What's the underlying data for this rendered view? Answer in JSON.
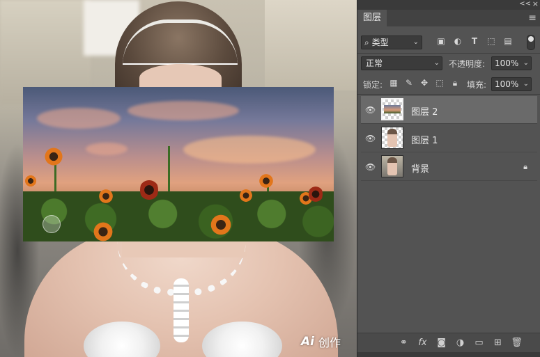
{
  "canvas": {
    "watermark_logo": "Ai",
    "watermark_text": "创作"
  },
  "panel": {
    "collapse_label": "<<",
    "close_label": "×",
    "tab_label": "图层",
    "menu_icon": "≡",
    "filter": {
      "kind_label": "类型",
      "icons": [
        "image-filter-icon",
        "adjustment-filter-icon",
        "type-filter-icon",
        "shape-filter-icon",
        "smart-object-filter-icon"
      ]
    },
    "blend_mode": "正常",
    "opacity_label": "不透明度:",
    "opacity_value": "100%",
    "lock_label": "锁定:",
    "fill_label": "填充:",
    "fill_value": "100%",
    "layers": [
      {
        "name": "图层 2",
        "selected": true,
        "visible": true,
        "locked": false
      },
      {
        "name": "图层 1",
        "selected": false,
        "visible": true,
        "locked": false
      },
      {
        "name": "背景",
        "selected": false,
        "visible": true,
        "locked": true
      }
    ],
    "bottom_icons": [
      "link-layers-icon",
      "fx-icon",
      "add-mask-icon",
      "adjustment-layer-icon",
      "group-folder-icon",
      "new-layer-icon",
      "delete-layer-icon"
    ]
  }
}
